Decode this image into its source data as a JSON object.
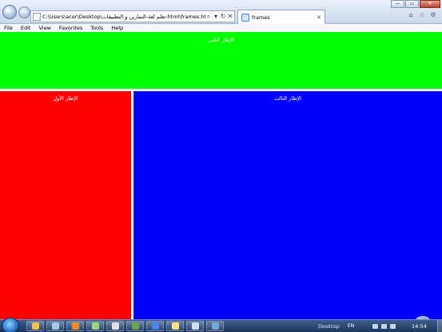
{
  "browser": {
    "address": "C:\\Users\\acer\\Desktop\\تعلم لغة-التمارين و التطبيقات-html\\frames.htm",
    "tab_title": "frames",
    "nav": {
      "back_glyph": "←",
      "forward_glyph": "→"
    },
    "address_icons": {
      "search": "⌕",
      "dropdown": "▾",
      "refresh": "↻",
      "stop": "✕"
    },
    "tab_close": "✕",
    "window_controls": {
      "minimize": "—",
      "maximize": "▭",
      "close": "✕"
    },
    "toolbar_icons": {
      "home": "⌂",
      "favorites": "☆",
      "tools": "⚙"
    }
  },
  "menu": [
    "File",
    "Edit",
    "View",
    "Favorites",
    "Tools",
    "Help"
  ],
  "frames": {
    "top": {
      "label": "الإطار الثاني",
      "color": "#00ff00"
    },
    "left": {
      "label": "الإطار الأول",
      "color": "#ff0000"
    },
    "right": {
      "label": "الإطار الثالث",
      "color": "#0000ff"
    }
  },
  "taskbar": {
    "desktop_label": "Desktop",
    "language": "EN",
    "clock": "14:54",
    "buttons": [
      {
        "name": "explorer",
        "color": "#f2c14e"
      },
      {
        "name": "library",
        "color": "#a7c7e7"
      },
      {
        "name": "media-player",
        "color": "#f08a24"
      },
      {
        "name": "tool-a",
        "color": "#9bd37a"
      },
      {
        "name": "tool-b",
        "color": "#e0e0e0"
      },
      {
        "name": "tool-c",
        "color": "#6aa84f"
      },
      {
        "name": "tool-d",
        "color": "#4a86e8"
      },
      {
        "name": "tool-e",
        "color": "#f3e08a"
      },
      {
        "name": "tool-f",
        "color": "#cfe2f3"
      },
      {
        "name": "tool-g",
        "color": "#6fa8dc"
      }
    ]
  }
}
